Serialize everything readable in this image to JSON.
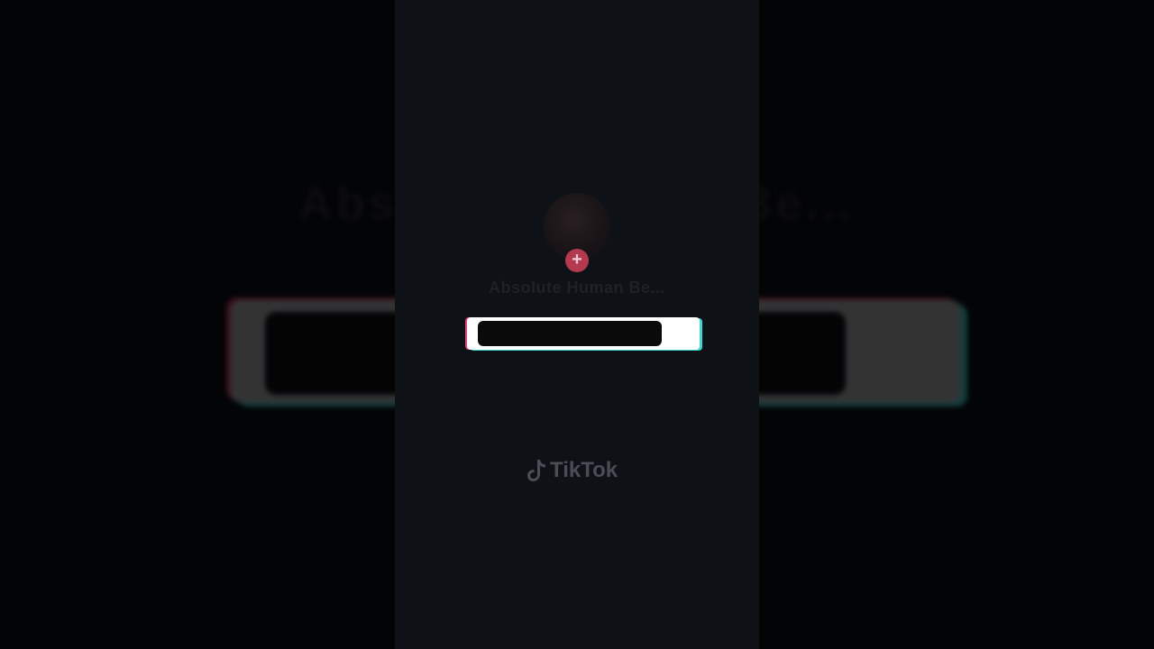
{
  "background": {
    "blurred_title": "Absolute Human Be..."
  },
  "profile": {
    "username": "Absolute Human Be...",
    "follow_symbol": "+"
  },
  "progress": {
    "fraction": 0
  },
  "brand": {
    "name": "TikTok",
    "icon": "tiktok-note-icon"
  },
  "colors": {
    "accent_pink": "#e0457a",
    "accent_cyan": "#3fd6d0",
    "follow_badge": "#b3394f"
  }
}
